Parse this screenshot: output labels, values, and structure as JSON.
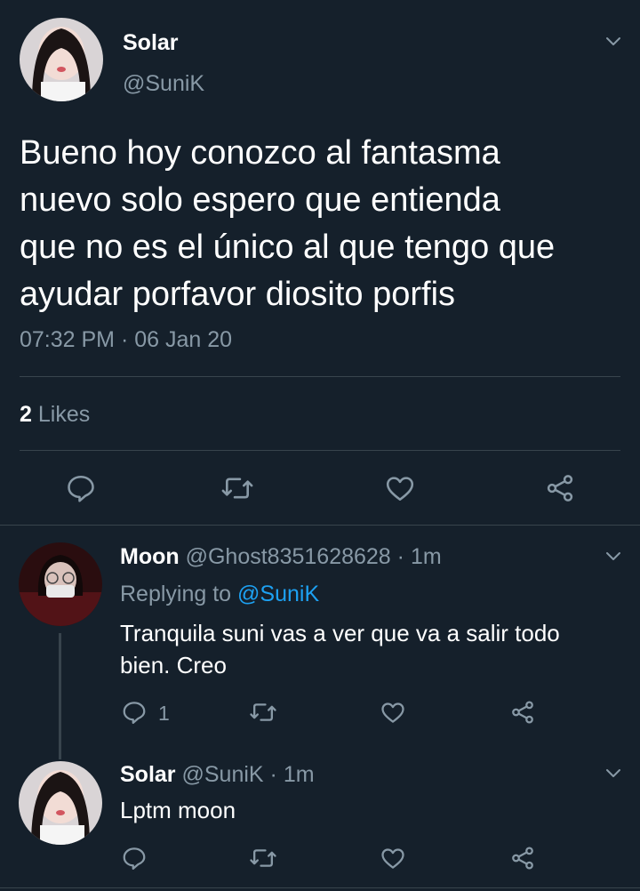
{
  "main_tweet": {
    "name": "Solar",
    "handle": "@SuniK",
    "text_lines": [
      "Bueno hoy conozco al fantasma",
      "nuevo solo espero que entienda",
      "que no es el único al que tengo que",
      "ayudar porfavor diosito porfis"
    ],
    "timestamp": "07:32 PM · 06 Jan 20",
    "likes_count": "2",
    "likes_label": "Likes"
  },
  "reply1": {
    "name": "Moon",
    "handle": "@Ghost8351628628",
    "separator": "·",
    "time": "1m",
    "replying_prefix": "Replying to",
    "replying_to": "@SuniK",
    "text_lines": [
      "Tranquila suni vas a ver que va a salir todo",
      "bien. Creo"
    ],
    "reply_count": "1"
  },
  "reply2": {
    "name": "Solar",
    "handle": "@SuniK",
    "separator": "·",
    "time": "1m",
    "text": "Lptm moon"
  },
  "colors": {
    "background": "#15202b",
    "text": "#ffffff",
    "muted": "#8899a6",
    "link": "#1da1f2",
    "divider": "#38444d"
  },
  "icons": [
    "chevron-down-icon",
    "reply-icon",
    "retweet-icon",
    "like-icon",
    "share-icon"
  ]
}
